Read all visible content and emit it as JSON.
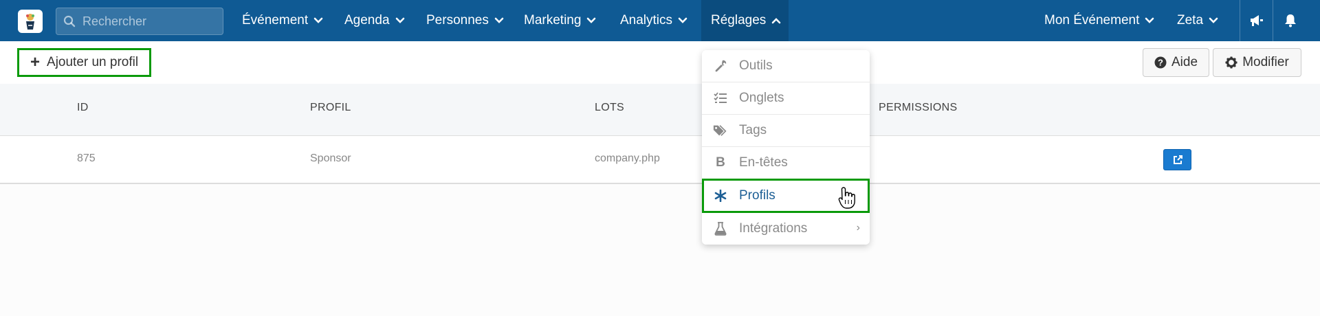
{
  "search": {
    "placeholder": "Rechercher"
  },
  "nav": {
    "items": [
      {
        "label": "Événement"
      },
      {
        "label": "Agenda"
      },
      {
        "label": "Personnes"
      },
      {
        "label": "Marketing"
      },
      {
        "label": "Analytics"
      },
      {
        "label": "Réglages"
      }
    ],
    "right": [
      {
        "label": "Mon Événement"
      },
      {
        "label": "Zeta"
      }
    ]
  },
  "toolbar": {
    "add_label": "Ajouter un profil",
    "help_label": "Aide",
    "edit_label": "Modifier"
  },
  "table": {
    "headers": [
      "ID",
      "PROFIL",
      "LOTS",
      "PERMISSIONS"
    ],
    "rows": [
      {
        "id": "875",
        "profil": "Sponsor",
        "lots": "company.php"
      }
    ]
  },
  "dropdown": {
    "items": [
      {
        "label": "Outils",
        "icon": "wrench-icon"
      },
      {
        "label": "Onglets",
        "icon": "list-check-icon"
      },
      {
        "label": "Tags",
        "icon": "tags-icon"
      },
      {
        "label": "En-têtes",
        "icon": "bold-icon"
      },
      {
        "label": "Profils",
        "icon": "asterisk-icon"
      },
      {
        "label": "Intégrations",
        "icon": "flask-icon"
      }
    ]
  },
  "colors": {
    "navbar": "#0f5a94",
    "active_nav": "#0b4c7e",
    "highlight": "#0a9a0a",
    "primary_button": "#1a7bd0"
  }
}
